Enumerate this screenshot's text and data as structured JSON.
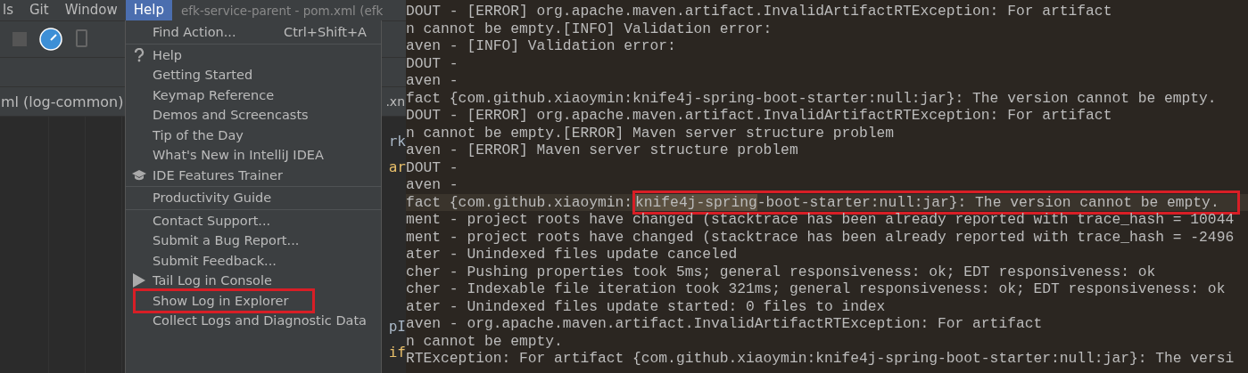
{
  "menu_bar": [
    {
      "label": "ls",
      "selected": false
    },
    {
      "label": "Git",
      "selected": false
    },
    {
      "label": "Window",
      "selected": false
    },
    {
      "label": "Help",
      "selected": true
    }
  ],
  "window_title": "efk-service-parent - pom.xml (efk",
  "editor_tabs": [
    {
      "label": "ml (log-common)"
    },
    {
      "label": ".xn"
    }
  ],
  "editor_fragments": [
    "rk",
    "ar",
    "pI",
    "if"
  ],
  "help_menu": [
    {
      "kind": "item",
      "label": "Find Action...",
      "shortcut": "Ctrl+Shift+A",
      "boxed": false
    },
    {
      "kind": "separator"
    },
    {
      "kind": "help",
      "label": "Help",
      "boxed": false
    },
    {
      "kind": "item",
      "label": "Getting Started",
      "boxed": false
    },
    {
      "kind": "item",
      "label": "Keymap Reference",
      "boxed": false
    },
    {
      "kind": "item",
      "label": "Demos and Screencasts",
      "boxed": false
    },
    {
      "kind": "item",
      "label": "Tip of the Day",
      "boxed": false
    },
    {
      "kind": "item",
      "label": "What's New in IntelliJ IDEA",
      "boxed": false
    },
    {
      "kind": "trainer",
      "label": "IDE Features Trainer",
      "boxed": false
    },
    {
      "kind": "separator"
    },
    {
      "kind": "item",
      "label": "Productivity Guide",
      "boxed": false
    },
    {
      "kind": "separator"
    },
    {
      "kind": "item",
      "label": "Contact Support...",
      "boxed": false
    },
    {
      "kind": "item",
      "label": "Submit a Bug Report...",
      "boxed": false
    },
    {
      "kind": "item",
      "label": "Submit Feedback...",
      "boxed": false
    },
    {
      "kind": "tail",
      "label": "Tail Log in Console",
      "boxed": false
    },
    {
      "kind": "item",
      "label": "Show Log in Explorer",
      "boxed": true
    },
    {
      "kind": "item",
      "label": "Collect Logs and Diagnostic Data",
      "boxed": false
    }
  ],
  "log_lines": [
    {
      "kind": "plain",
      "text": "DOUT - [ERROR] org.apache.maven.artifact.InvalidArtifactRTException: For artifact"
    },
    {
      "kind": "plain",
      "text": "n cannot be empty.[INFO] Validation error:"
    },
    {
      "kind": "plain",
      "text": "aven - [INFO] Validation error:"
    },
    {
      "kind": "plain",
      "text": "DOUT -"
    },
    {
      "kind": "plain",
      "text": "aven -"
    },
    {
      "kind": "plain",
      "text": "fact {com.github.xiaoymin:knife4j-spring-boot-starter:null:jar}: The version cannot be empty."
    },
    {
      "kind": "plain",
      "text": "DOUT - [ERROR] org.apache.maven.artifact.InvalidArtifactRTException: For artifact"
    },
    {
      "kind": "plain",
      "text": "n cannot be empty.[ERROR] Maven server structure problem"
    },
    {
      "kind": "plain",
      "text": "aven - [ERROR] Maven server structure problem"
    },
    {
      "kind": "plain",
      "text": "DOUT -"
    },
    {
      "kind": "plain",
      "text": "aven -"
    },
    {
      "kind": "match",
      "before": "fact {com.github.xiaoymin:",
      "match": "knife4j-spring",
      "after": "-boot-starter:null:jar}: The version cannot be empty.",
      "boxed": true
    },
    {
      "kind": "plain",
      "text": "ment - project roots have changed (stacktrace has been already reported with trace_hash = 10044"
    },
    {
      "kind": "plain",
      "text": "ment - project roots have changed (stacktrace has been already reported with trace_hash = -2496"
    },
    {
      "kind": "plain",
      "text": "ater - Unindexed files update canceled"
    },
    {
      "kind": "plain",
      "text": "cher - Pushing properties took 5ms; general responsiveness: ok; EDT responsiveness: ok"
    },
    {
      "kind": "plain",
      "text": "cher - Indexable file iteration took 321ms; general responsiveness: ok; EDT responsiveness: ok"
    },
    {
      "kind": "plain",
      "text": "ater - Unindexed files update started: 0 files to index"
    },
    {
      "kind": "plain",
      "text": "aven - org.apache.maven.artifact.InvalidArtifactRTException: For artifact"
    },
    {
      "kind": "plain",
      "text": "n cannot be empty."
    },
    {
      "kind": "plain",
      "text": "RTException: For artifact {com.github.xiaoymin:knife4j-spring-boot-starter:null:jar}: The versi"
    }
  ]
}
